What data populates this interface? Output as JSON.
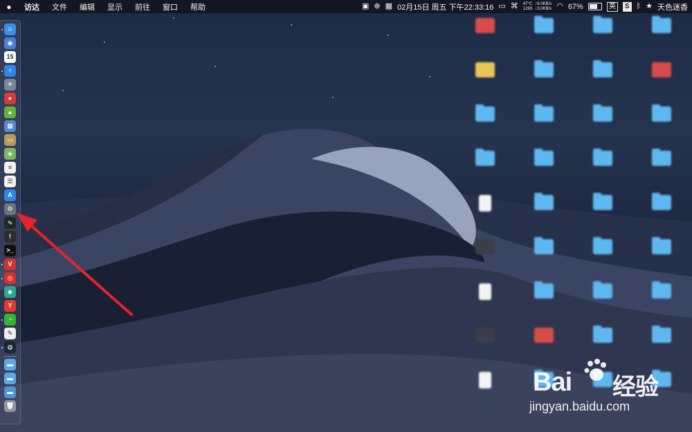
{
  "menubar": {
    "apple_icon": "apple-logo",
    "items": [
      "访达",
      "文件",
      "编辑",
      "显示",
      "前往",
      "窗口",
      "帮助"
    ],
    "temp": "47°C",
    "fan": "1293",
    "net_up": "↑6.0KB/s",
    "net_down": "↓3.0KB/s",
    "datetime": "02月15日 周五 下午22:33:16",
    "battery": "67%",
    "ime_en": "英",
    "ime_s": "S",
    "username": "天色迷香"
  },
  "dock": {
    "items": [
      {
        "name": "finder-icon",
        "glyph": "☺",
        "color": "#3d8fe6"
      },
      {
        "name": "siri-icon",
        "glyph": "◉",
        "color": "#4a7fd8"
      },
      {
        "name": "calendar-icon",
        "glyph": "15",
        "color": "#ffffff"
      },
      {
        "name": "safari-icon",
        "glyph": "✧",
        "color": "#2f85e8"
      },
      {
        "name": "launchpad-icon",
        "glyph": "✈",
        "color": "#7c8597"
      },
      {
        "name": "app-red-icon",
        "glyph": "●",
        "color": "#d63a3a"
      },
      {
        "name": "android-icon",
        "glyph": "▲",
        "color": "#62b43c"
      },
      {
        "name": "preview-icon",
        "glyph": "▦",
        "color": "#5a88c8"
      },
      {
        "name": "notes-icon",
        "glyph": "▭",
        "color": "#b89a5c"
      },
      {
        "name": "maps-icon",
        "glyph": "◈",
        "color": "#7fb760"
      },
      {
        "name": "textedit-icon",
        "glyph": "≡",
        "color": "#f2f2f2"
      },
      {
        "name": "reminders-icon",
        "glyph": "☰",
        "color": "#f2f2f2"
      },
      {
        "name": "appstore-icon",
        "glyph": "A",
        "color": "#2f86e9"
      },
      {
        "name": "system-prefs-icon",
        "glyph": "⚙",
        "color": "#6d7480"
      },
      {
        "name": "activity-monitor-icon",
        "glyph": "∿",
        "color": "#1d2a22"
      },
      {
        "name": "console-icon",
        "glyph": "!",
        "color": "#2c2c2c"
      },
      {
        "name": "terminal-icon",
        "glyph": ">_",
        "color": "#111111"
      },
      {
        "name": "vivaldi-icon",
        "glyph": "V",
        "color": "#d73232"
      },
      {
        "name": "netease-music-icon",
        "glyph": "◎",
        "color": "#d7302e"
      },
      {
        "name": "app-teal-icon",
        "glyph": "◆",
        "color": "#28a98c"
      },
      {
        "name": "yandex-icon",
        "glyph": "Y",
        "color": "#e33a2f"
      },
      {
        "name": "wechat-icon",
        "glyph": "◔",
        "color": "#34b53a"
      },
      {
        "name": "pages-icon",
        "glyph": "✎",
        "color": "#eeeeee"
      },
      {
        "name": "steam-icon",
        "glyph": "◍",
        "color": "#1b2838"
      },
      {
        "name": "folder-icon",
        "glyph": "▬",
        "color": "#5aa9e6"
      },
      {
        "name": "downloads-folder-icon",
        "glyph": "▬",
        "color": "#5aa9e6"
      },
      {
        "name": "documents-folder-icon",
        "glyph": "▬",
        "color": "#4d95d6"
      },
      {
        "name": "trash-icon",
        "glyph": "🗑",
        "color": "#8e95a3"
      }
    ]
  },
  "watermark": {
    "brand_left": "Bai",
    "brand_right": "经验",
    "url": "jingyan.baidu.com"
  },
  "colors": {
    "arrow": "#e8222a"
  }
}
